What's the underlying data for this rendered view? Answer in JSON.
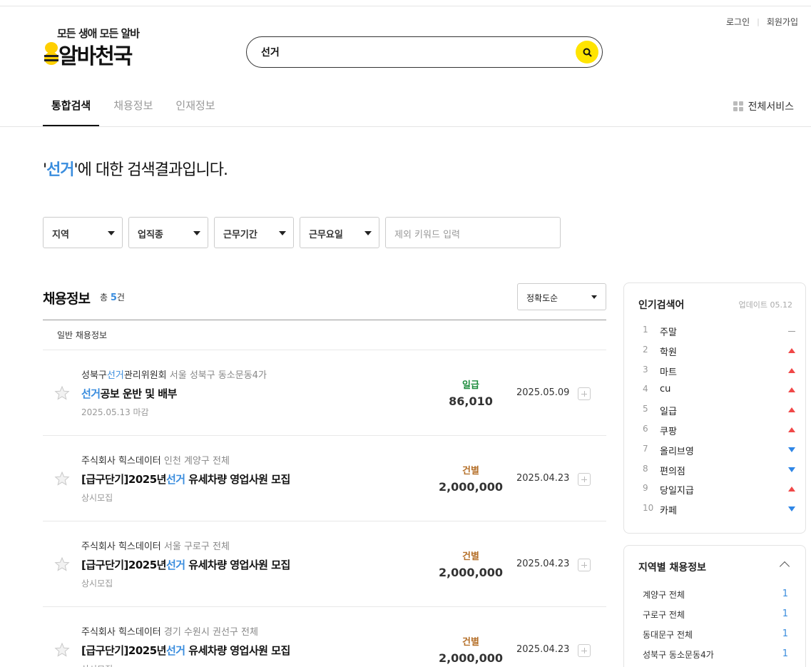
{
  "header": {
    "login_label": "로그인",
    "signup_label": "회원가입",
    "logo_tagline": "모든 생애 모든 알바",
    "logo_brand": "알바천국",
    "search_value": "선거",
    "all_services_label": "전체서비스"
  },
  "tabs": [
    {
      "label": "통합검색",
      "active": true
    },
    {
      "label": "채용정보",
      "active": false
    },
    {
      "label": "인재정보",
      "active": false
    }
  ],
  "result": {
    "quote_open": "'",
    "keyword": "선거",
    "suffix": "'에 대한 검색결과입니다."
  },
  "filters": {
    "region": "지역",
    "job_type": "업직종",
    "period": "근무기간",
    "weekday": "근무요일",
    "exclude_placeholder": "제외 키워드 입력"
  },
  "jobs_section": {
    "title": "채용정보",
    "count_prefix": "총",
    "count": "5",
    "count_suffix": "건",
    "sort_label": "정확도순",
    "subheading": "일반 채용정보"
  },
  "jobs": [
    {
      "company_pre": "성북구",
      "company_hl": "선거",
      "company_post": "관리위원회",
      "location": "서울 성북구 동소문동4가",
      "title_pre": "",
      "title_hl": "선거",
      "title_post": "공보 운반 및 배부",
      "deadline": "2025.05.13 마감",
      "pay_type": "일급",
      "pay_type_color": "#1a8a3a",
      "pay": "86,010",
      "date": "2025.05.09"
    },
    {
      "company_pre": "주식회사 힉스데이터",
      "company_hl": "",
      "company_post": "",
      "location": "인천 계양구 전체",
      "title_pre": "[급구단기]2025년",
      "title_hl": "선거",
      "title_post": " 유세차량 영업사원 모집",
      "deadline": "상시모집",
      "pay_type": "건별",
      "pay_type_color": "#b5702a",
      "pay": "2,000,000",
      "date": "2025.04.23"
    },
    {
      "company_pre": "주식회사 힉스데이터",
      "company_hl": "",
      "company_post": "",
      "location": "서울 구로구 전체",
      "title_pre": "[급구단기]2025년",
      "title_hl": "선거",
      "title_post": " 유세차량 영업사원 모집",
      "deadline": "상시모집",
      "pay_type": "건별",
      "pay_type_color": "#b5702a",
      "pay": "2,000,000",
      "date": "2025.04.23"
    },
    {
      "company_pre": "주식회사 힉스데이터",
      "company_hl": "",
      "company_post": "",
      "location": "경기 수원시 권선구 전체",
      "title_pre": "[급구단기]2025년",
      "title_hl": "선거",
      "title_post": " 유세차량 영업사원 모집",
      "deadline": "상시모집",
      "pay_type": "건별",
      "pay_type_color": "#b5702a",
      "pay": "2,000,000",
      "date": "2025.04.23"
    }
  ],
  "popular": {
    "title": "인기검색어",
    "update_label": "업데이트 05.12",
    "items": [
      {
        "rank": "1",
        "keyword": "주말",
        "trend": "same"
      },
      {
        "rank": "2",
        "keyword": "학원",
        "trend": "up"
      },
      {
        "rank": "3",
        "keyword": "마트",
        "trend": "up"
      },
      {
        "rank": "4",
        "keyword": "cu",
        "trend": "up"
      },
      {
        "rank": "5",
        "keyword": "일급",
        "trend": "up"
      },
      {
        "rank": "6",
        "keyword": "쿠팡",
        "trend": "up"
      },
      {
        "rank": "7",
        "keyword": "올리브영",
        "trend": "down"
      },
      {
        "rank": "8",
        "keyword": "편의점",
        "trend": "down"
      },
      {
        "rank": "9",
        "keyword": "당일지급",
        "trend": "up"
      },
      {
        "rank": "10",
        "keyword": "카페",
        "trend": "down"
      }
    ]
  },
  "regions": {
    "title": "지역별 채용정보",
    "items": [
      {
        "name": "계양구 전체",
        "count": "1"
      },
      {
        "name": "구로구 전체",
        "count": "1"
      },
      {
        "name": "동대문구 전체",
        "count": "1"
      },
      {
        "name": "성북구 동소문동4가",
        "count": "1"
      }
    ]
  },
  "colors": {
    "accent_blue": "#3a8dde",
    "search_button_yellow": "#ffe400",
    "trend_up": "#f04848",
    "trend_down": "#2f86e6"
  },
  "icons": {
    "search_button": "search-icon",
    "star": "star-icon",
    "add": "plus-icon",
    "grid": "grid-icon",
    "collapse": "chevron-up-icon"
  }
}
